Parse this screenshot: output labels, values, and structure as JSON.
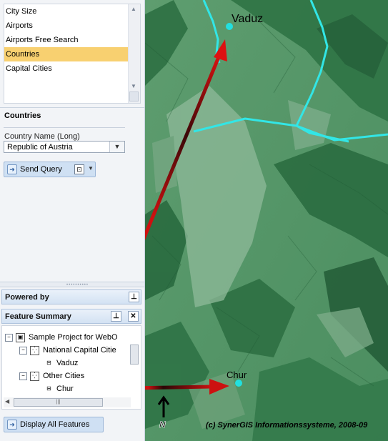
{
  "query_list": {
    "items": [
      "City Size",
      "Airports",
      "Airports Free Search",
      "Countries",
      "Capital Cities"
    ],
    "selected": "Countries"
  },
  "query_form": {
    "title": "Countries",
    "field_label": "Country Name (Long)",
    "field_value": "Republic of Austria",
    "send_button": "Send Query"
  },
  "panels": {
    "powered_by": "Powered by",
    "feature_summary": "Feature Summary"
  },
  "tree": {
    "project": "Sample Project for WebO",
    "group1": "National Capital Citie",
    "group1_item": "Vaduz",
    "group2": "Other Cities",
    "group2_item": "Chur"
  },
  "display_all_button": "Display All Features",
  "map": {
    "cities": [
      "Vaduz",
      "Chur"
    ],
    "north_label": "N",
    "copyright": "(c) SynerGIS Informationssysteme, 2008-09",
    "colors": {
      "terrain": "#3f8a57",
      "border": "#32e6e6",
      "arrow": "#dd1111",
      "city_dot": "#22e0e0"
    }
  }
}
